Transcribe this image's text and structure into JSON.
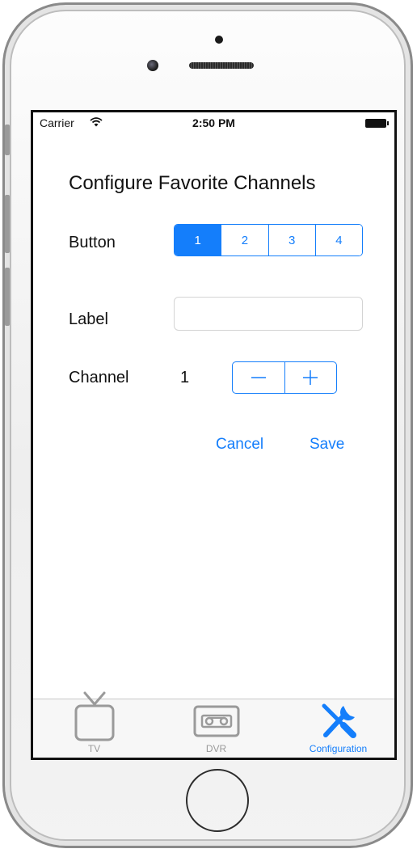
{
  "status_bar": {
    "carrier": "Carrier",
    "time": "2:50 PM"
  },
  "title": "Configure Favorite Channels",
  "button_row": {
    "label": "Button",
    "segments": [
      "1",
      "2",
      "3",
      "4"
    ],
    "selected_index": 0
  },
  "label_row": {
    "label": "Label",
    "value": "",
    "placeholder": ""
  },
  "channel_row": {
    "label": "Channel",
    "value": "1"
  },
  "actions": {
    "cancel": "Cancel",
    "save": "Save"
  },
  "tabs": [
    {
      "label": "TV",
      "icon": "tv-icon"
    },
    {
      "label": "DVR",
      "icon": "cassette-icon"
    },
    {
      "label": "Configuration",
      "icon": "tools-icon",
      "active": true
    }
  ],
  "colors": {
    "accent": "#147efb",
    "inactive_tab": "#9a9a9a"
  }
}
